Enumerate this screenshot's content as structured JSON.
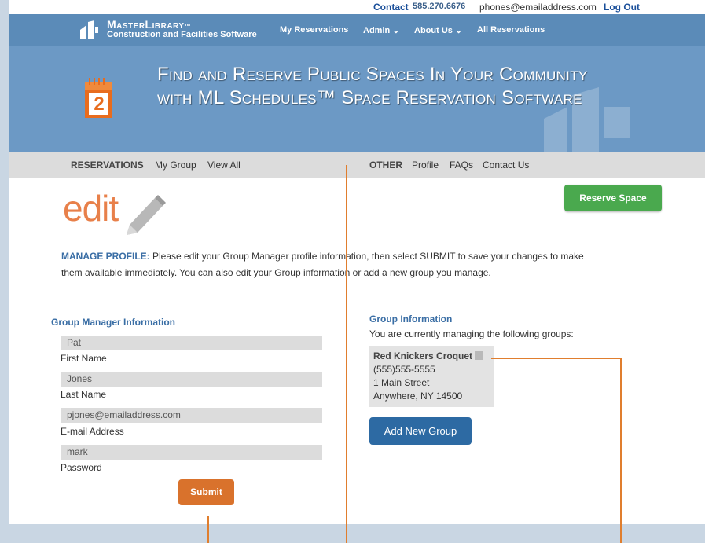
{
  "topbar": {
    "contact_label": "Contact",
    "phone": "585.270.6676",
    "email": "phones@emailaddress.com",
    "logout": "Log Out"
  },
  "brand": {
    "name": "MasterLibrary",
    "tm": "™",
    "tagline": "Construction and Facilities Software"
  },
  "nav": {
    "items": [
      {
        "label": "My Reservations"
      },
      {
        "label": "Admin ⌄"
      },
      {
        "label": "About Us ⌄"
      },
      {
        "label": "All Reservations"
      }
    ]
  },
  "hero": {
    "line1": "Find and Reserve Public Spaces In Your Community",
    "line2": "with ML Schedules™ Space Reservation Software",
    "calendar_number": "2"
  },
  "subnav": {
    "reservations_head": "RESERVATIONS",
    "my_group": "My Group",
    "view_all": "View All",
    "other_head": "OTHER",
    "profile": "Profile",
    "faqs": "FAQs",
    "contact_us": "Contact Us"
  },
  "page": {
    "title": "edit",
    "reserve_button": "Reserve Space"
  },
  "manage": {
    "label": "MANAGE PROFILE:",
    "text": " Please edit your Group Manager profile information, then select SUBMIT to save your changes to make them available immediately. You can also edit your Group information or add a new group you manage."
  },
  "manager": {
    "title": "Group Manager Information",
    "fields": [
      {
        "value": "Pat",
        "label": "First Name"
      },
      {
        "value": "Jones",
        "label": "Last Name"
      },
      {
        "value": "pjones@emailaddress.com",
        "label": "E-mail Address"
      },
      {
        "value": "mark",
        "label": "Password"
      }
    ],
    "submit": "Submit"
  },
  "groups": {
    "title": "Group Information",
    "subtitle": "You are currently managing the following groups:",
    "group": {
      "name": "Red Knickers Croquet",
      "phone": "(555)555-5555",
      "street": "1 Main Street",
      "city": "Anywhere, NY 14500"
    },
    "add_button": "Add New Group"
  },
  "colors": {
    "accent_orange": "#e07e2e",
    "nav_blue": "#5b8bb8",
    "green": "#4aa94e",
    "link_blue": "#3a6ea5"
  }
}
